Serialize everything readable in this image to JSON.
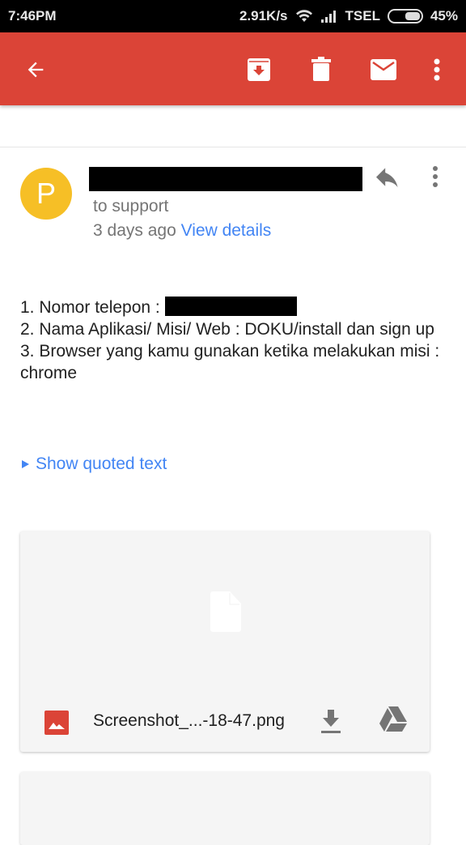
{
  "status_bar": {
    "time": "7:46PM",
    "speed": "2.91K/s",
    "carrier": "TSEL",
    "battery": "45%"
  },
  "toolbar": {
    "back": "arrow-back",
    "actions": [
      "archive",
      "delete",
      "mark-unread",
      "more"
    ]
  },
  "message": {
    "avatar_letter": "P",
    "to": "to support",
    "time": "3 days ago",
    "view_details": "View details",
    "body": {
      "line1": "1. Nomor telepon : ",
      "line2": "2. Nama Aplikasi/ Misi/ Web : DOKU/install dan sign up",
      "line3": "3. Browser yang kamu gunakan ketika melakukan misi : chrome"
    },
    "show_quoted": "Show quoted text"
  },
  "attachment": {
    "filename": "Screenshot_...-18-47.png",
    "colors": {
      "image_icon": "#db4437"
    }
  },
  "colors": {
    "appbar": "#db4437",
    "avatar": "#f6bf26",
    "link": "#4285f4"
  }
}
